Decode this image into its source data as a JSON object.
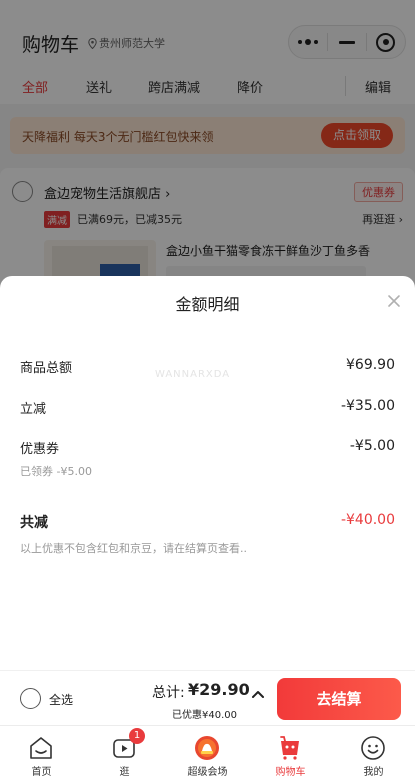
{
  "header": {
    "title": "购物车",
    "location": "贵州师范大学"
  },
  "tabs": [
    {
      "label": "全部",
      "active": true
    },
    {
      "label": "送礼",
      "active": false
    },
    {
      "label": "跨店满减",
      "active": false
    },
    {
      "label": "降价",
      "active": false
    }
  ],
  "edit_label": "编辑",
  "banner": {
    "text": "天降福利 每天3个无门槛红包快来领",
    "button": "点击领取"
  },
  "store": {
    "name": "盒边宠物生活旗舰店 ›",
    "coupon_tag": "优惠券",
    "promo_tag": "满减",
    "promo_text": "已满69元，已减35元",
    "more": "再逛逛 ›",
    "product_title": "盒边小鱼干猫零食冻干鲜鱼沙丁鱼多香"
  },
  "sheet": {
    "title": "金额明细",
    "watermark": "WANNARXDA",
    "rows": [
      {
        "label": "商品总额",
        "value": "¥69.90"
      },
      {
        "label": "立减",
        "value": "-¥35.00"
      },
      {
        "label": "优惠券",
        "value": "-¥5.00",
        "sub": "已领券 -¥5.00"
      }
    ],
    "total": {
      "label": "共减",
      "value": "-¥40.00"
    },
    "note": "以上优惠不包含红包和京豆，请在结算页查看.."
  },
  "checkout": {
    "select_all": "全选",
    "sum_label": "总计:",
    "sum_value": "¥29.90",
    "saved": "已优惠¥40.00",
    "button": "去结算"
  },
  "tabbar": [
    {
      "label": "首页",
      "icon": "home-icon",
      "active": false
    },
    {
      "label": "逛",
      "icon": "video-icon",
      "active": false,
      "badge": "1"
    },
    {
      "label": "超级会场",
      "icon": "promo-venue-icon",
      "active": false
    },
    {
      "label": "购物车",
      "icon": "cart-icon",
      "active": true
    },
    {
      "label": "我的",
      "icon": "profile-icon",
      "active": false
    }
  ],
  "colors": {
    "accent": "#e93b3d",
    "banner_bg": "#fde8d5",
    "overlay": "rgba(0,0,0,0.45)"
  }
}
